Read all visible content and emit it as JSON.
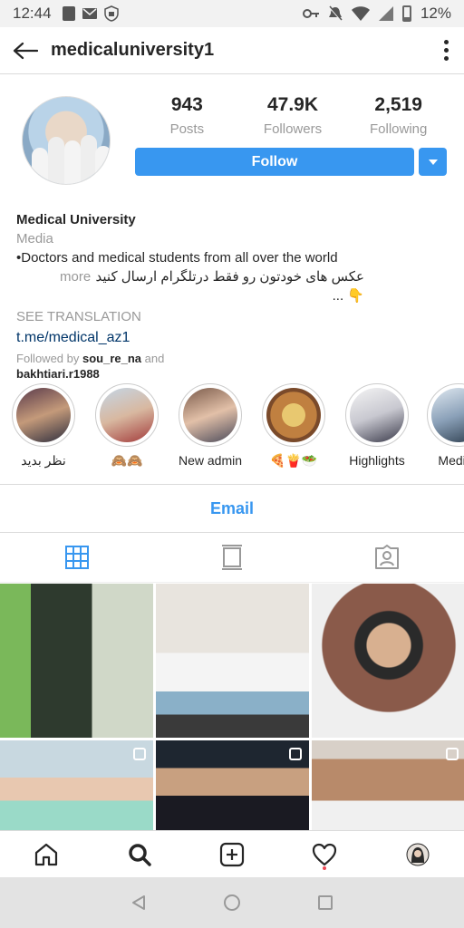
{
  "status_bar": {
    "time": "12:44",
    "battery": "12%"
  },
  "header": {
    "username": "medicaluniversity1"
  },
  "stats": [
    {
      "value": "943",
      "label": "Posts"
    },
    {
      "value": "47.9K",
      "label": "Followers"
    },
    {
      "value": "2,519",
      "label": "Following"
    }
  ],
  "follow_label": "Follow",
  "bio": {
    "name": "Medical University",
    "category": "Media",
    "line1": "•Doctors and medical students from all over the world",
    "line2": "عکس های خودتون رو فقط درتلگرام ارسال کنید👇 ...",
    "more": "more",
    "see_translation": "SEE TRANSLATION",
    "link": "t.me/medical_az1",
    "followed_prefix": "Followed by",
    "followed_user1": "sou_re_na",
    "followed_and": "and",
    "followed_user2": "bakhtiari.r1988"
  },
  "highlights": [
    {
      "label": "نظر بدید"
    },
    {
      "label": "🙈🙈"
    },
    {
      "label": "New admin"
    },
    {
      "label": "🍕🍟🥗"
    },
    {
      "label": "Highlights"
    },
    {
      "label": "Medica"
    }
  ],
  "email_label": "Email",
  "colors": {
    "accent": "#3897f0",
    "notification": "#ed4956"
  }
}
